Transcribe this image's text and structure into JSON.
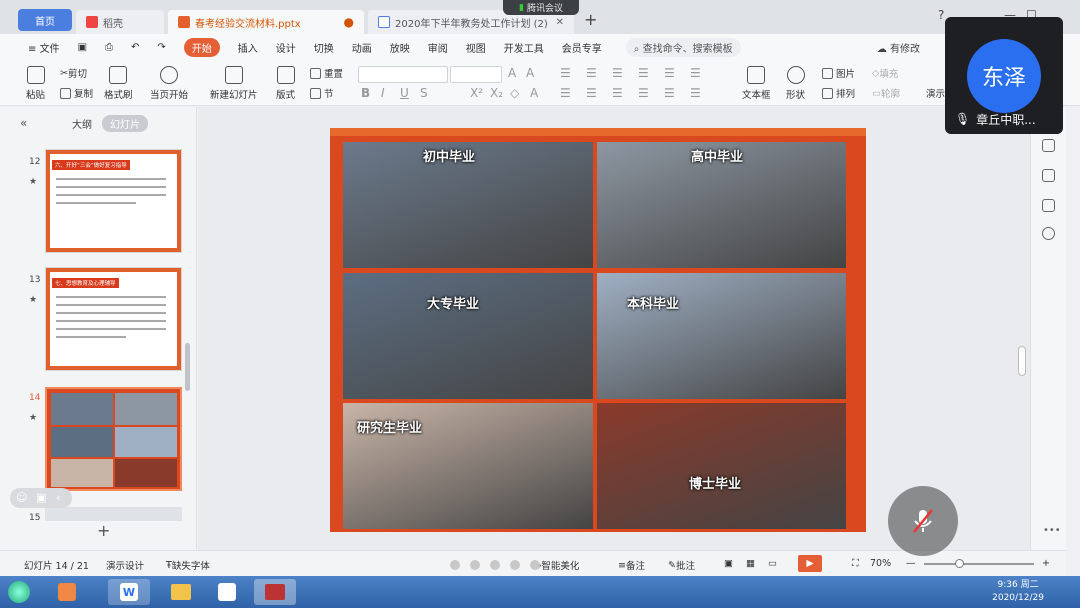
{
  "tabs": {
    "home": "首页",
    "daoke": "稻壳",
    "active": "春考经验交流材料.pptx",
    "second": "2020年下半年教务处工作计划 (2)"
  },
  "meeting_pill": "腾讯会议",
  "menu": {
    "file": "文件",
    "items": [
      "开始",
      "插入",
      "设计",
      "切换",
      "动画",
      "放映",
      "审阅",
      "视图",
      "开发工具",
      "会员专享"
    ],
    "search": "查找命令、搜索模板",
    "modified": "有修改"
  },
  "toolbar": {
    "paste": "粘贴",
    "cut": "剪切",
    "copy": "复制",
    "format_painter": "格式刷",
    "from_current": "当页开始",
    "new_slide": "新建幻灯片",
    "layout": "版式",
    "reset": "重置",
    "section": "节",
    "textbox": "文本框",
    "shape": "形状",
    "picture": "图片",
    "arrange": "排列",
    "fill": "填充",
    "outline": "轮廓",
    "present": "演示"
  },
  "left_panel": {
    "outline": "大纲",
    "slides": "幻灯片",
    "thumbs": [
      {
        "num": "12",
        "title": "六、开好“三会”做好复习指导"
      },
      {
        "num": "13",
        "title": "七、思想教育及心理辅导"
      },
      {
        "num": "14",
        "title": ""
      },
      {
        "num": "15",
        "title": ""
      }
    ]
  },
  "slide": {
    "cells": [
      {
        "label": "初中毕业",
        "color": "#6b7a8c"
      },
      {
        "label": "高中毕业",
        "color": "#8d97a2"
      },
      {
        "label": "大专毕业",
        "color": "#5c6e82"
      },
      {
        "label": "本科毕业",
        "color": "#9fb0c4"
      },
      {
        "label": "研究生毕业",
        "color": "#c9b5a8"
      },
      {
        "label": "博士毕业",
        "color": "#8a3a2a"
      }
    ]
  },
  "statusbar": {
    "slide_info": "幻灯片 14 / 21",
    "design": "演示设计",
    "missing_font": "缺失字体",
    "beautify": "智能美化",
    "notes": "备注",
    "comments": "批注",
    "zoom": "70%"
  },
  "meeting": {
    "avatar_text": "东泽",
    "name": "章丘中职..."
  },
  "clock": {
    "time": "9:36 周二",
    "date": "2020/12/29"
  },
  "colors": {
    "accent": "#e45f35",
    "home_tab": "#4a7fe0",
    "avatar": "#2a6ff0"
  }
}
